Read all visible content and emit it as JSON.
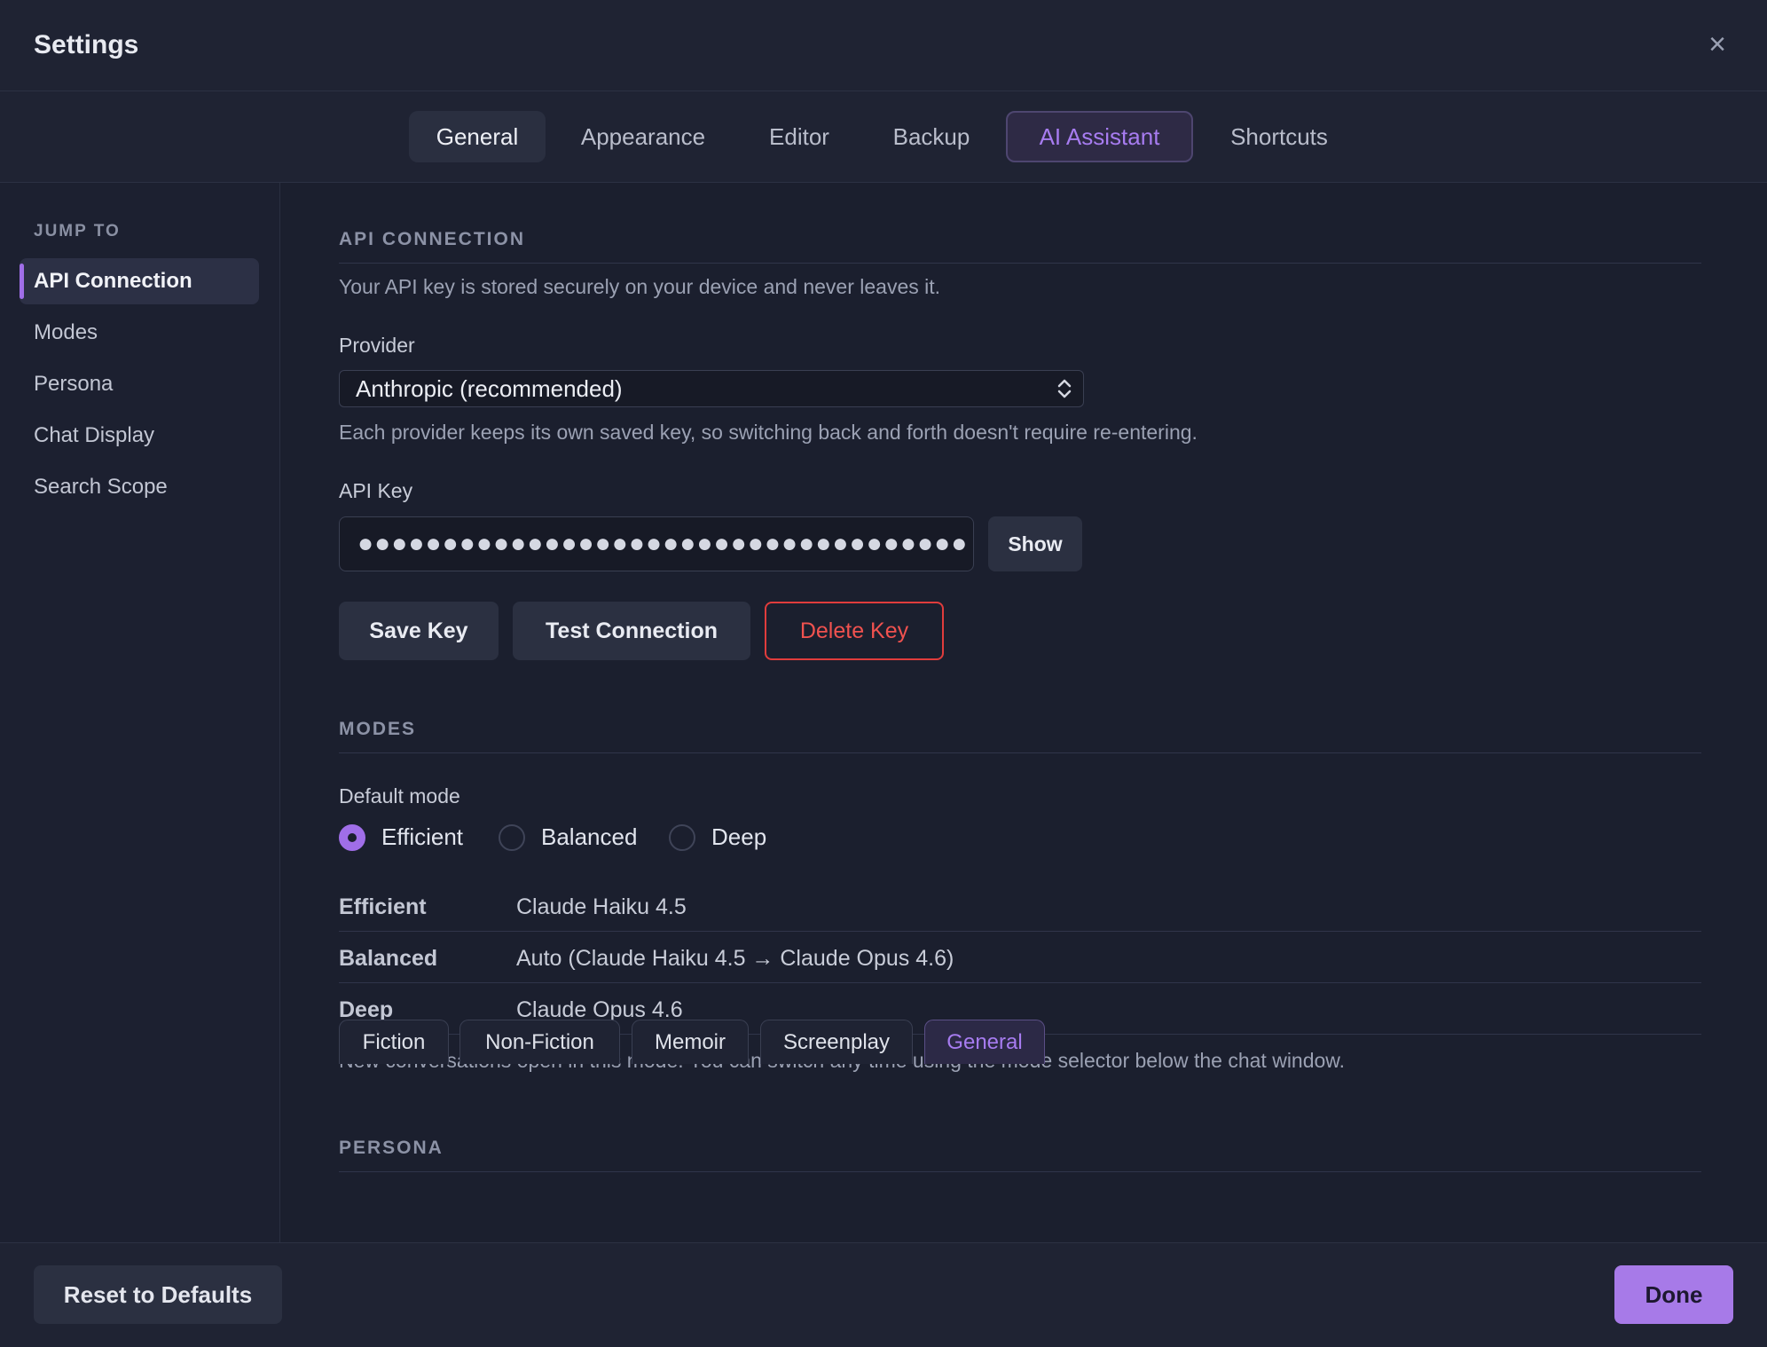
{
  "window": {
    "title": "Settings",
    "close_icon": "close-icon"
  },
  "tabs": [
    {
      "label": "General",
      "state": "highlighted"
    },
    {
      "label": "Appearance"
    },
    {
      "label": "Editor"
    },
    {
      "label": "Backup"
    },
    {
      "label": "AI Assistant",
      "state": "active"
    },
    {
      "label": "Shortcuts"
    }
  ],
  "sidebar": {
    "heading": "JUMP TO",
    "items": [
      {
        "label": "API Connection",
        "active": true
      },
      {
        "label": "Modes"
      },
      {
        "label": "Persona"
      },
      {
        "label": "Chat Display"
      },
      {
        "label": "Search Scope"
      }
    ]
  },
  "api": {
    "heading": "API CONNECTION",
    "description": "Your API key is stored securely on your device and never leaves it.",
    "provider_label": "Provider",
    "provider_value": "Anthropic (recommended)",
    "provider_hint": "Each provider keeps its own saved key, so switching back and forth doesn't require re-entering.",
    "key_label": "API Key",
    "key_value": "●●●●●●●●●●●●●●●●●●●●●●●●●●●●●●●●●●●●",
    "show_label": "Show",
    "save_label": "Save Key",
    "test_label": "Test Connection",
    "delete_label": "Delete Key"
  },
  "modes": {
    "heading": "MODES",
    "default_label": "Default mode",
    "options": [
      {
        "label": "Efficient",
        "selected": true
      },
      {
        "label": "Balanced"
      },
      {
        "label": "Deep"
      }
    ],
    "table": [
      {
        "name": "Efficient",
        "model": "Claude Haiku 4.5"
      },
      {
        "name": "Balanced",
        "model": "Auto (Claude Haiku 4.5 → Claude Opus 4.6)"
      },
      {
        "name": "Deep",
        "model": "Claude Opus 4.6"
      }
    ],
    "note": "New conversations open in this mode. You can switch any time using the mode selector below the chat window."
  },
  "persona": {
    "heading": "PERSONA",
    "options": [
      {
        "label": "Fiction"
      },
      {
        "label": "Non-Fiction"
      },
      {
        "label": "Memoir"
      },
      {
        "label": "Screenplay"
      },
      {
        "label": "General",
        "selected": true
      }
    ]
  },
  "footer": {
    "reset_label": "Reset to Defaults",
    "done_label": "Done"
  },
  "colors": {
    "accent": "#a06ee8",
    "danger": "#e03c3c",
    "background": "#1b1f2e"
  }
}
